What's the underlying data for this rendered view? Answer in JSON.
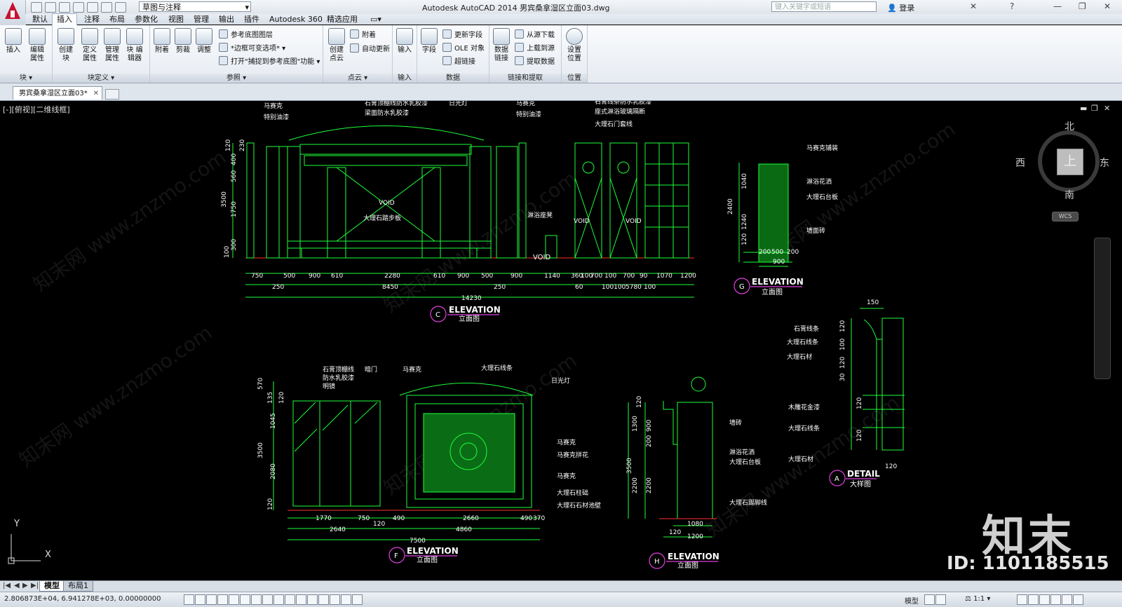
{
  "window": {
    "title": "Autodesk AutoCAD 2014    男宾桑拿湿区立面03.dwg",
    "workspace": "草图与注释",
    "search_placeholder": "键入关键字或短语",
    "login": "登录"
  },
  "menu_tabs": [
    "默认",
    "插入",
    "注释",
    "布局",
    "参数化",
    "视图",
    "管理",
    "输出",
    "插件",
    "Autodesk 360",
    "精选应用"
  ],
  "ribbon": {
    "block_panel": {
      "title": "块 ▾",
      "insert": "插入",
      "edit_attr": "编辑\n属性"
    },
    "block_def_panel": {
      "title": "块定义 ▾",
      "create": "创建\n块",
      "define_attr": "定义\n属性",
      "manage_attr": "管理\n属性",
      "block_editor": "块\n编辑器"
    },
    "reference_panel": {
      "title": "参照 ▾",
      "attach": "附着",
      "clip": "剪裁",
      "adjust": "调整",
      "underlay_layers": "参考底图图层",
      "frame_var": "*边框可变选项* ▾",
      "snap_underlay": "打开\"捕捉到参考底图\"功能 ▾"
    },
    "pointcloud_panel": {
      "title": "点云 ▾",
      "create": "创建\n点云",
      "attach": "附着",
      "auto_update": "自动更新"
    },
    "import_panel": {
      "title": "输入",
      "import": "输入"
    },
    "data_panel": {
      "title": "数据",
      "field": "字段",
      "update_fields": "更新字段",
      "ole": "OLE 对象",
      "hyperlink": "超链接"
    },
    "linking_panel": {
      "title": "链接和提取",
      "data_link": "数据\n链接",
      "download": "从源下载",
      "upload": "上载到源",
      "extract": "提取数据"
    },
    "location_panel": {
      "title": "位置",
      "set_location": "设置\n位置"
    }
  },
  "doc_tab": "男宾桑拿湿区立面03*",
  "viewport_label": "[-][俯视][二维线框]",
  "viewcube": {
    "north": "北",
    "south": "南",
    "east": "东",
    "west": "西",
    "top": "上",
    "wcs": "WCS"
  },
  "watermark": "知末网 www.znzmo.com",
  "brand": "知末",
  "id_text": "ID: 1101185515",
  "layout_tabs": [
    "模型",
    "布局1"
  ],
  "status": {
    "coords": "2.806873E+04, 6.941278E+03, 0.00000000",
    "model": "模型",
    "scale": "1:1"
  },
  "drawings": {
    "C": {
      "letter": "C",
      "title": "ELEVATION",
      "subtitle": "立面图",
      "labels": [
        "马赛克",
        "特别油漆",
        "石膏顶棚线防水乳胶漆",
        "梁面防水乳胶漆",
        "日光灯",
        "马赛克",
        "特别油漆",
        "石膏线条防水乳胶漆",
        "座式淋浴玻璃隔断",
        "大理石门套线",
        "VOID",
        "大理石踏步板",
        "淋浴座凳",
        "VOID",
        "VOID"
      ],
      "dims_row1": [
        "750",
        "500",
        "900",
        "610",
        "2280",
        "610",
        "900",
        "500",
        "900",
        "1140",
        "360",
        "100",
        "700",
        "100",
        "700",
        "90",
        "1070",
        "1200"
      ],
      "dims_row2": [
        "250",
        "8450",
        "250",
        "60",
        "100100",
        "5780",
        "100"
      ],
      "dims_total": "14230",
      "vdims": [
        "120",
        "230",
        "400",
        "560",
        "1750",
        "3500",
        "300",
        "100"
      ]
    },
    "G": {
      "letter": "G",
      "title": "ELEVATION",
      "subtitle": "立面图",
      "labels": [
        "马赛克铺装",
        "淋浴花洒",
        "大理石台板",
        "墙面砖"
      ],
      "dims": [
        "200",
        "500",
        "200",
        "900"
      ],
      "vdims": [
        "1040",
        "2400",
        "1240",
        "120"
      ]
    },
    "F": {
      "letter": "F",
      "title": "ELEVATION",
      "subtitle": "立面图",
      "labels": [
        "石膏顶棚线",
        "防水乳胶漆",
        "明镜",
        "暗门",
        "马赛克",
        "大理石线条",
        "日光灯",
        "马赛克",
        "马赛克拼花",
        "马赛克",
        "大理石柱础",
        "大理石石材池壁"
      ],
      "dims_row1": [
        "1770",
        "750",
        "120",
        "490",
        "2660",
        "490",
        "370"
      ],
      "dims_row2": [
        "2640",
        "4860"
      ],
      "dims_total": "7500",
      "vdims": [
        "570",
        "135",
        "120",
        "1045",
        "3500",
        "2080",
        "120"
      ]
    },
    "H": {
      "letter": "H",
      "title": "ELEVATION",
      "subtitle": "立面图",
      "labels": [
        "墙砖",
        "淋浴花洒",
        "大理石台板",
        "大理石踢脚线"
      ],
      "dims": [
        "1080",
        "120",
        "1200"
      ],
      "vdims": [
        "120",
        "1300",
        "900",
        "200",
        "3500",
        "2200",
        "2200"
      ]
    },
    "A": {
      "letter": "A",
      "title": "DETAIL",
      "subtitle": "大样图",
      "labels": [
        "石膏线条",
        "大理石线条",
        "大理石材",
        "木雕花金漆",
        "大理石线条",
        "大理石材"
      ],
      "dims": [
        "150",
        "120",
        "100",
        "120",
        "30",
        "120",
        "120",
        "120"
      ]
    }
  }
}
